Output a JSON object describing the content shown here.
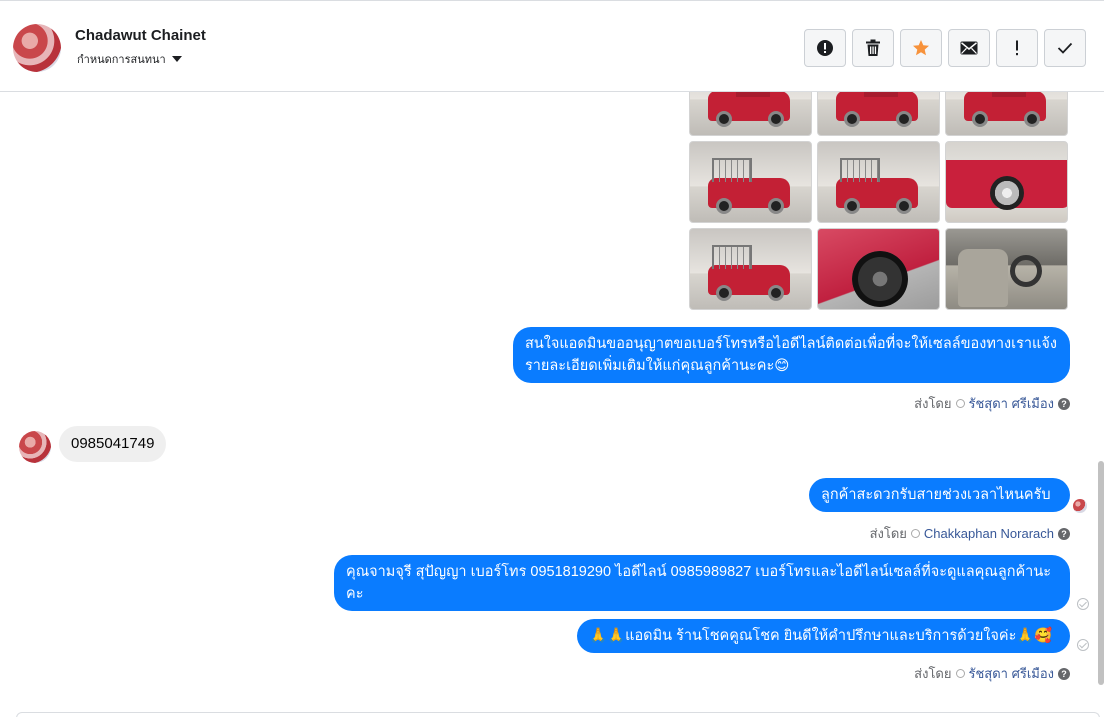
{
  "header": {
    "contact_name": "Chadawut Chainet",
    "conversation_action": "กำหนดการสนทนา",
    "actions": [
      {
        "name": "spam",
        "icon": "alert-circle-icon"
      },
      {
        "name": "delete",
        "icon": "trash-icon"
      },
      {
        "name": "star",
        "icon": "star-icon",
        "color": "#f7923b"
      },
      {
        "name": "mark-unread",
        "icon": "envelope-icon"
      },
      {
        "name": "follow-up",
        "icon": "exclamation-icon",
        "label": "!"
      },
      {
        "name": "mark-done",
        "icon": "checkmark-icon"
      }
    ]
  },
  "messages": [
    {
      "direction": "out",
      "text": "สนใจแอดมินขออนุญาตขอเบอร์โทรหรือไอดีไลน์ติดต่อเพื่อที่จะให้เซลล์ของทางเราแจ้งรายละเอียดเพิ่มเติมให้แก่คุณลูกค้านะคะ😊",
      "sent_by_prefix": "ส่งโดย",
      "sent_by_name": "รัชสุดา ศรีเมือง"
    },
    {
      "direction": "in",
      "text": "0985041749"
    },
    {
      "direction": "out",
      "text": "ลูกค้าสะดวกรับสายช่วงเวลาไหนครับ",
      "sent_by_prefix": "ส่งโดย",
      "sent_by_name": "Chakkaphan Norarach"
    },
    {
      "direction": "out",
      "text": "คุณจามจุรี สุปัญญา เบอร์โทร 0951819290  ไอดีไลน์ 0985989827  เบอร์โทรและไอดีไลน์เซลล์ที่จะดูแลคุณลูกค้านะคะ"
    },
    {
      "direction": "out",
      "text": "🙏🙏แอดมิน ร้านโชคคูณโชค ยินดีให้คำปรึกษาและบริการด้วยใจค่ะ🙏🥰",
      "sent_by_prefix": "ส่งโดย",
      "sent_by_name": "รัชสุดา ศรีเมือง"
    }
  ],
  "colors": {
    "outgoing_bubble": "#0a7cff",
    "incoming_bubble": "#efefef",
    "star": "#f7923b"
  }
}
